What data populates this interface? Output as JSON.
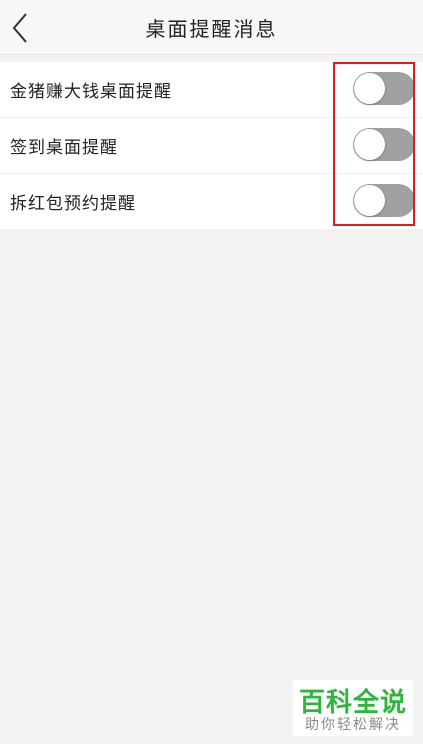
{
  "header": {
    "title": "桌面提醒消息",
    "back_icon": "chevron-left-icon"
  },
  "settings": [
    {
      "label": "金猪赚大钱桌面提醒",
      "enabled": false
    },
    {
      "label": "签到桌面提醒",
      "enabled": false
    },
    {
      "label": "拆红包预约提醒",
      "enabled": false
    }
  ],
  "watermark": {
    "title": "百科全说",
    "subtitle": "助你轻松解决"
  },
  "colors": {
    "highlight": "#e01b1b",
    "toggle_off": "#a0a0a0",
    "watermark_green": "#2db53c"
  }
}
